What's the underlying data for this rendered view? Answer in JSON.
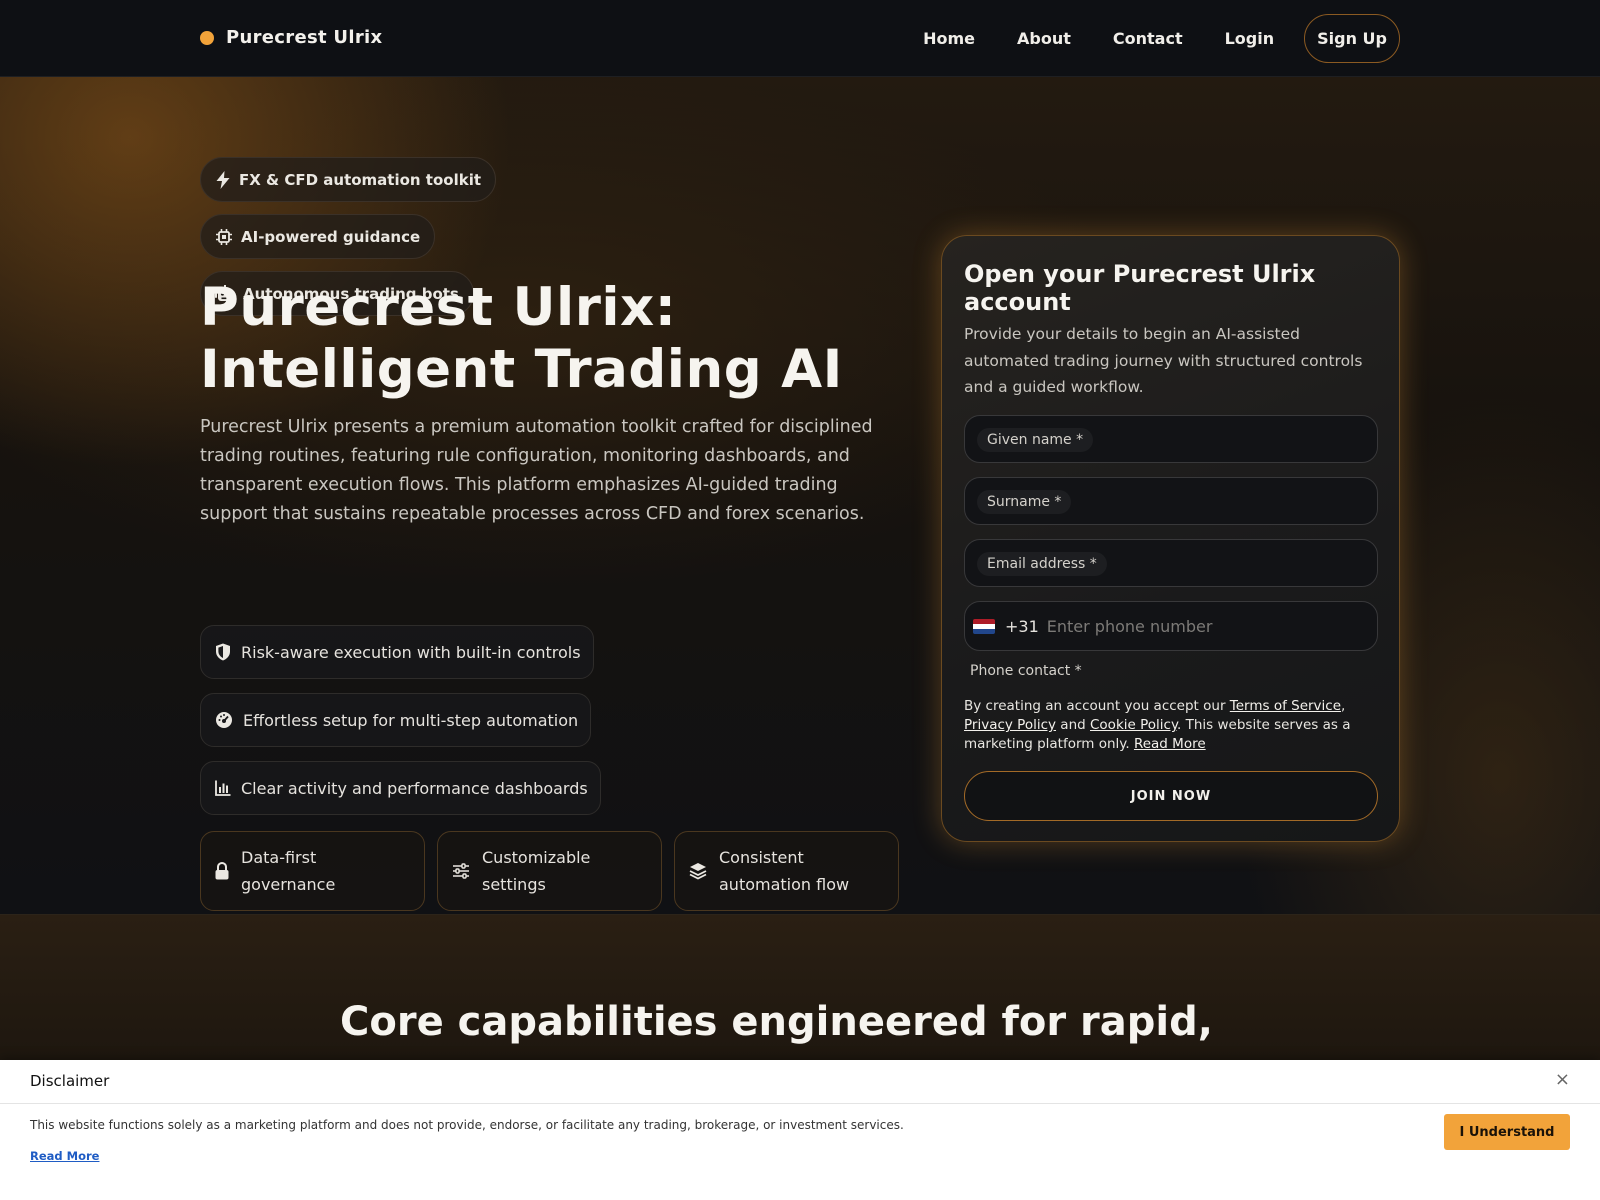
{
  "header": {
    "brand_name": "Purecrest Ulrix",
    "nav": [
      "Home",
      "About",
      "Contact",
      "Login"
    ],
    "signup_label": "Sign Up"
  },
  "hero": {
    "chips": [
      {
        "label": "FX & CFD automation toolkit",
        "icon": "bolt-icon"
      },
      {
        "label": "AI-powered guidance",
        "icon": "chip-icon"
      },
      {
        "label": "Autonomous trading bots",
        "icon": "robot-icon"
      }
    ],
    "title_line1": "Purecrest Ulrix:",
    "title_line2": "Intelligent Trading AI",
    "description": "Purecrest Ulrix presents a premium automation toolkit crafted for disciplined trading routines, featuring rule configuration, monitoring dashboards, and transparent execution flows. This platform emphasizes AI-guided trading support that sustains repeatable processes across CFD and forex scenarios.",
    "features": [
      {
        "label": "Risk-aware execution with built-in controls",
        "icon": "shield-icon"
      },
      {
        "label": "Effortless setup for multi-step automation",
        "icon": "gauge-icon"
      },
      {
        "label": "Clear activity and performance dashboards",
        "icon": "bar-chart-icon"
      }
    ],
    "cards": [
      {
        "line1": "Data-first",
        "line2": "governance",
        "icon": "lock-icon"
      },
      {
        "line1": "Customizable",
        "line2": "settings",
        "icon": "sliders-icon"
      },
      {
        "line1": "Consistent",
        "line2": "automation flow",
        "icon": "layers-icon"
      }
    ]
  },
  "form": {
    "title": "Open your Purecrest Ulrix account",
    "subtitle": "Provide your details to begin an AI-assisted automated trading journey with structured controls and a guided workflow.",
    "given_name_label": "Given name *",
    "surname_label": "Surname *",
    "email_label": "Email address *",
    "dial_code": "+31",
    "phone_placeholder": "Enter phone number",
    "phone_label": "Phone contact *",
    "terms_prefix": "By creating an account you accept our ",
    "terms_link": "Terms of Service",
    "comma": ",",
    "privacy_link": "Privacy Policy",
    "and_text": " and ",
    "cookie_link": "Cookie Policy",
    "terms_suffix": ". This website serves as a marketing platform only. ",
    "read_more": "Read More",
    "join_label": "JOIN NOW"
  },
  "core": {
    "title": "Core capabilities engineered for rapid,"
  },
  "disclaimer": {
    "title": "Disclaimer",
    "close": "×",
    "text": "This website functions solely as a marketing platform and does not provide, endorse, or facilitate any trading, brokerage, or investment services.",
    "read_more": "Read More",
    "button": "I Understand"
  },
  "colors": {
    "accent": "#f2a33a",
    "background": "#0d0f13",
    "panel_border": "#6b4a20"
  }
}
